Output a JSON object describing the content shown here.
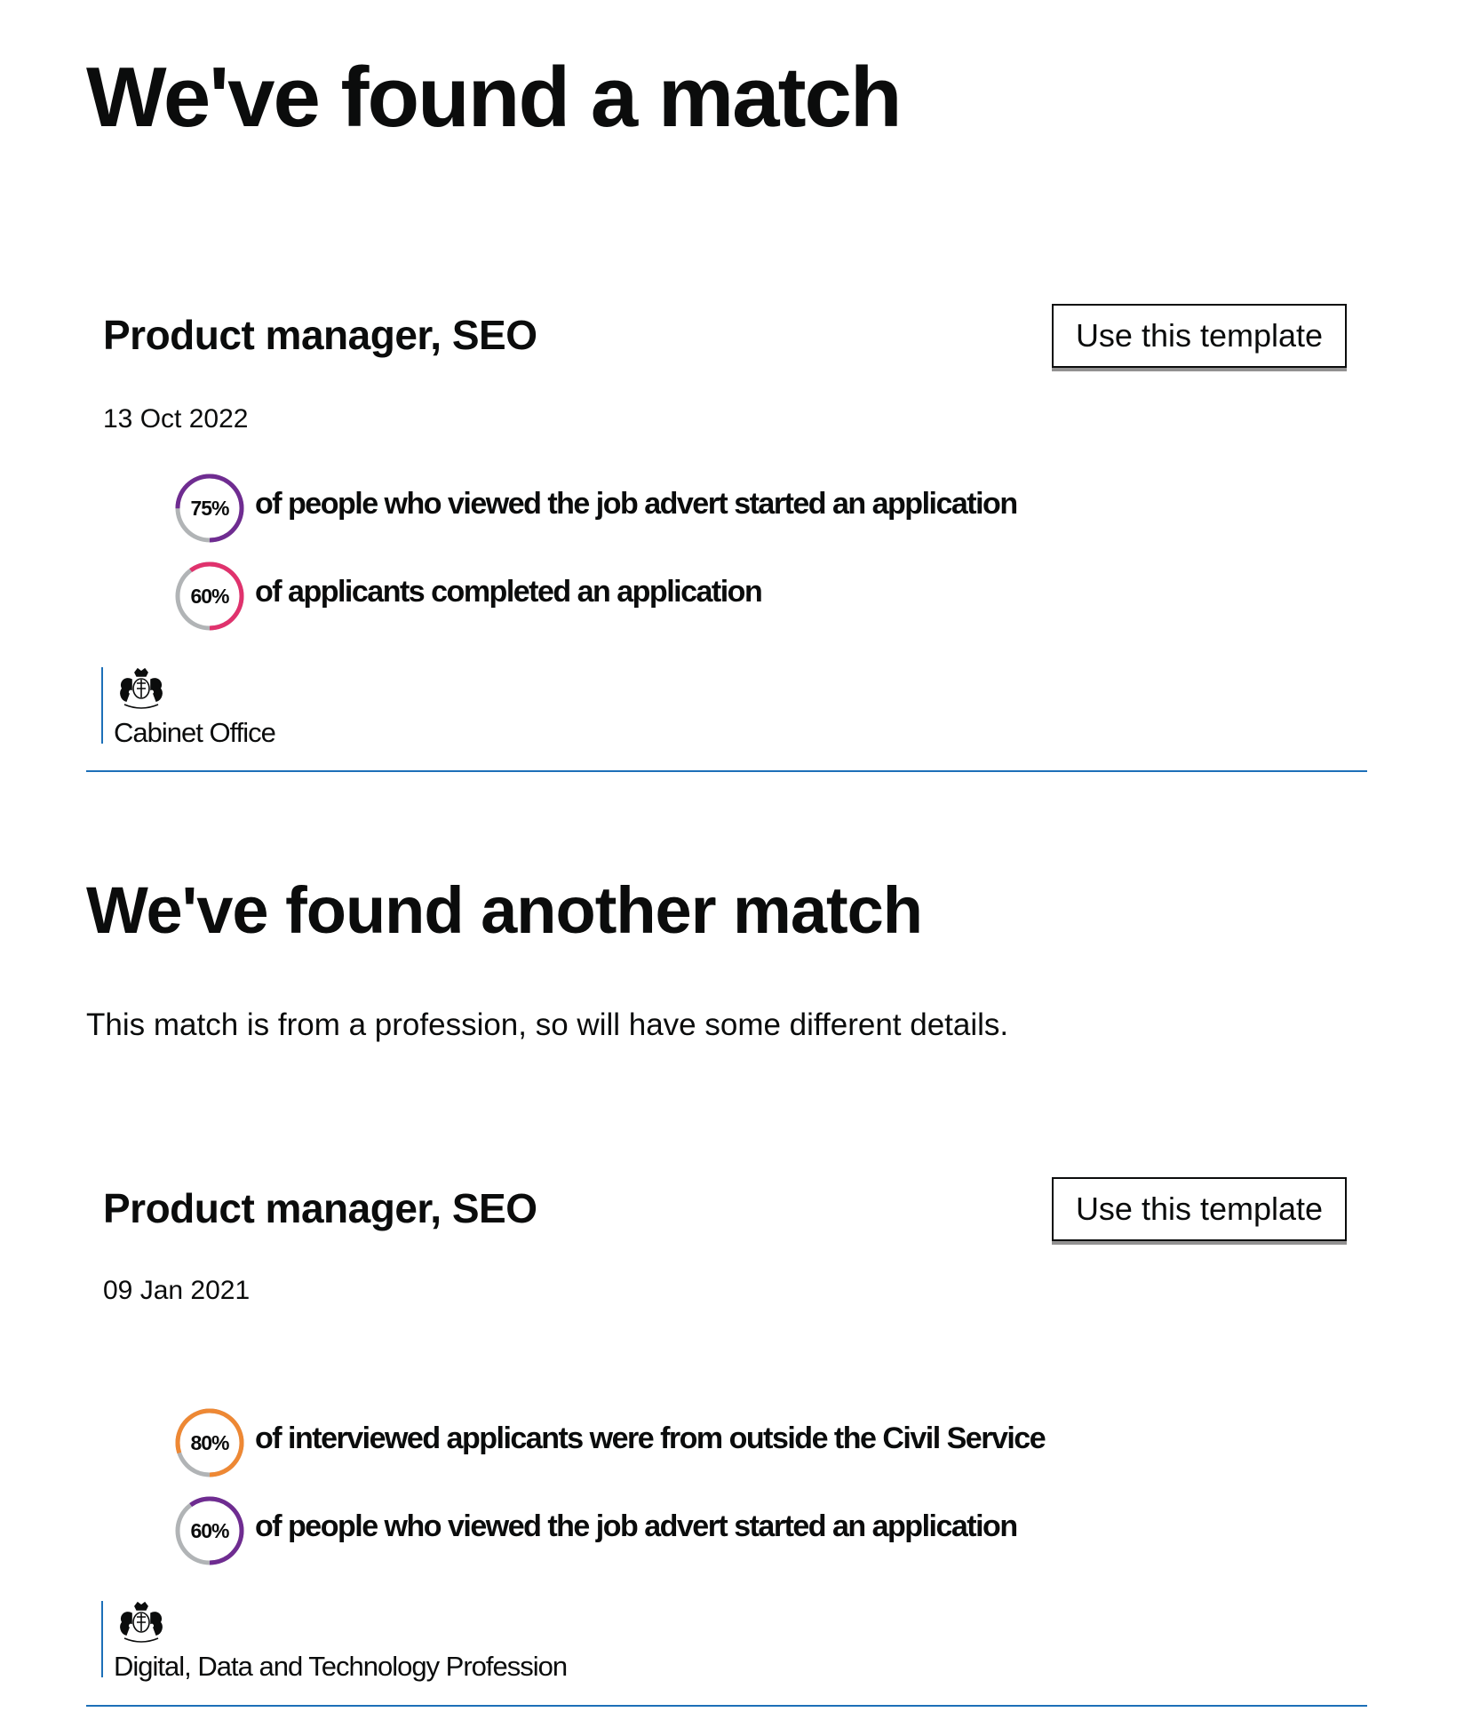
{
  "headings": {
    "first_match": "We've found a match",
    "second_match": "We've found another match",
    "second_match_lead": "This match is from a profession, so will have some different details."
  },
  "matches": [
    {
      "title": "Product manager, SEO",
      "button_label": "Use this template",
      "date": "13 Oct 2022",
      "stats": [
        {
          "value": 75,
          "label": "75%",
          "text": "of people who viewed the job advert started an application",
          "color": "#6f2c91",
          "icon": "progress-ring-icon"
        },
        {
          "value": 60,
          "label": "60%",
          "text": "of applicants completed an application",
          "color": "#e0326d",
          "icon": "progress-ring-icon"
        }
      ],
      "organisation": {
        "name": "Cabinet Office",
        "icon": "royal-crest-icon"
      }
    },
    {
      "title": "Product manager, SEO",
      "button_label": "Use this template",
      "date": "09 Jan 2021",
      "stats": [
        {
          "value": 80,
          "label": "80%",
          "text": "of interviewed applicants were from outside the Civil Service",
          "color": "#ee8834",
          "icon": "progress-ring-icon"
        },
        {
          "value": 60,
          "label": "60%",
          "text": "of people who viewed the job advert started an application",
          "color": "#6f2c91",
          "icon": "progress-ring-icon"
        }
      ],
      "organisation": {
        "name": "Digital, Data and Technology Profession",
        "icon": "royal-crest-icon"
      }
    }
  ],
  "colors": {
    "text": "#0b0c0c",
    "divider": "#1d70b8",
    "ring_track": "#b1b4b6",
    "button_shadow": "#929191"
  }
}
